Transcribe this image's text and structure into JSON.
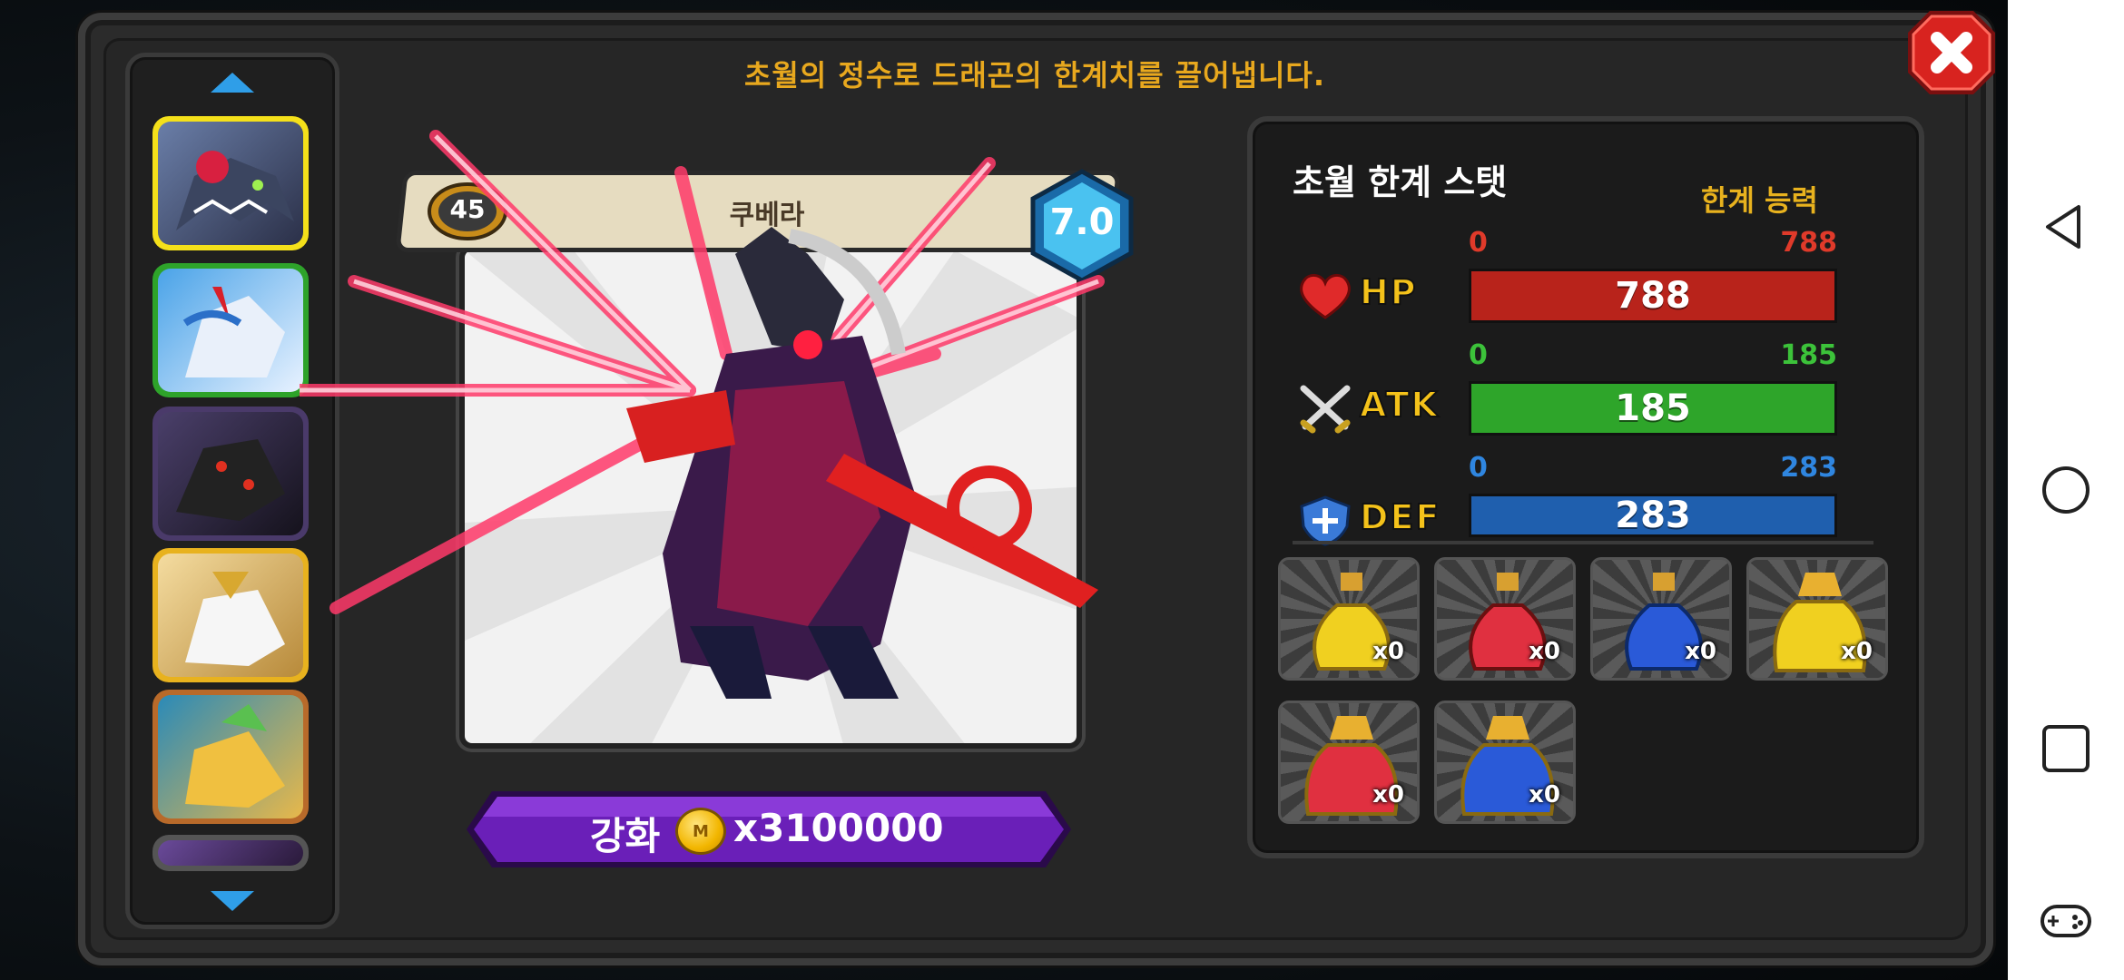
{
  "header": {
    "subtitle": "초월의 정수로 드래곤의 한계치를 끌어냅니다."
  },
  "dragon": {
    "name": "쿠베라",
    "level": "45",
    "grade": "7.0"
  },
  "upgrade": {
    "label": "강화",
    "coin_symbol": "M",
    "price": "x3100000"
  },
  "stats": {
    "title": "초월 한계 스탯",
    "subtitle": "한계 능력",
    "rows": [
      {
        "label": "HP",
        "min": "0",
        "max": "788",
        "value": "788",
        "color": "#b8231b",
        "minmax_color": "#e03a2a",
        "fill": 1.0
      },
      {
        "label": "ATK",
        "min": "0",
        "max": "185",
        "value": "185",
        "color": "#2ea52a",
        "minmax_color": "#3cc23a",
        "fill": 1.0
      },
      {
        "label": "DEF",
        "min": "0",
        "max": "283",
        "value": "283",
        "color": "#1f5fae",
        "minmax_color": "#2f86e0",
        "fill": 1.0
      }
    ]
  },
  "items": [
    {
      "icon": "yellow-potion-icon",
      "count": "x0"
    },
    {
      "icon": "red-potion-icon",
      "count": "x0"
    },
    {
      "icon": "blue-potion-icon",
      "count": "x0"
    },
    {
      "icon": "large-yellow-potion-icon",
      "count": "x0"
    },
    {
      "icon": "large-red-potion-icon",
      "count": "x0"
    },
    {
      "icon": "large-blue-potion-icon",
      "count": "x0"
    }
  ],
  "colors": {
    "accent": "#e8a81e",
    "upgrade_button": "#6a1fb8",
    "selected_border": "#f4e01a"
  }
}
